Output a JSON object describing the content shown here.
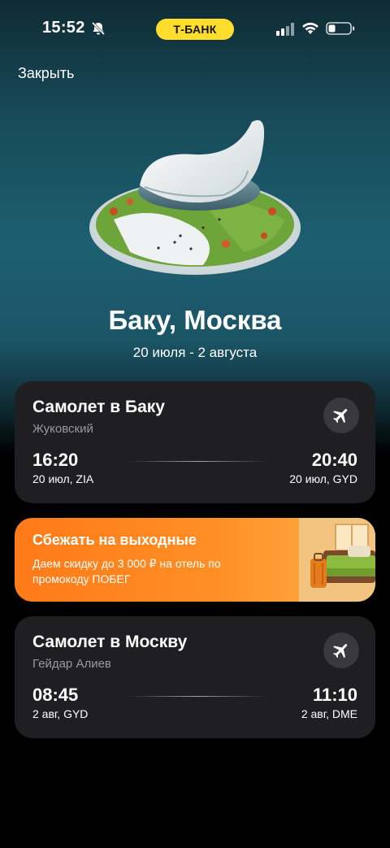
{
  "status_bar": {
    "time": "15:52",
    "bank_label": "Т-БАНК",
    "bank_color": "#ffdd2d"
  },
  "header": {
    "close_label": "Закрыть"
  },
  "trip": {
    "title": "Баку, Москва",
    "dates": "20 июля - 2 августа"
  },
  "flights": [
    {
      "title": "Самолет в Баку",
      "airport": "Жуковский",
      "departure_time": "16:20",
      "departure_info": "20 июл, ZIA",
      "arrival_time": "20:40",
      "arrival_info": "20 июл, GYD",
      "icon": "airplane-icon"
    },
    {
      "title": "Самолет в Москву",
      "airport": "Гейдар Алиев",
      "departure_time": "08:45",
      "departure_info": "2 авг, GYD",
      "arrival_time": "11:10",
      "arrival_info": "2 авг, DME",
      "icon": "airplane-icon"
    }
  ],
  "promo": {
    "title": "Сбежать на выходные",
    "text": "Даем скидку до 3 000 ₽ на отель по промокоду ПОБЕГ",
    "accent_color": "#ff8f24"
  }
}
